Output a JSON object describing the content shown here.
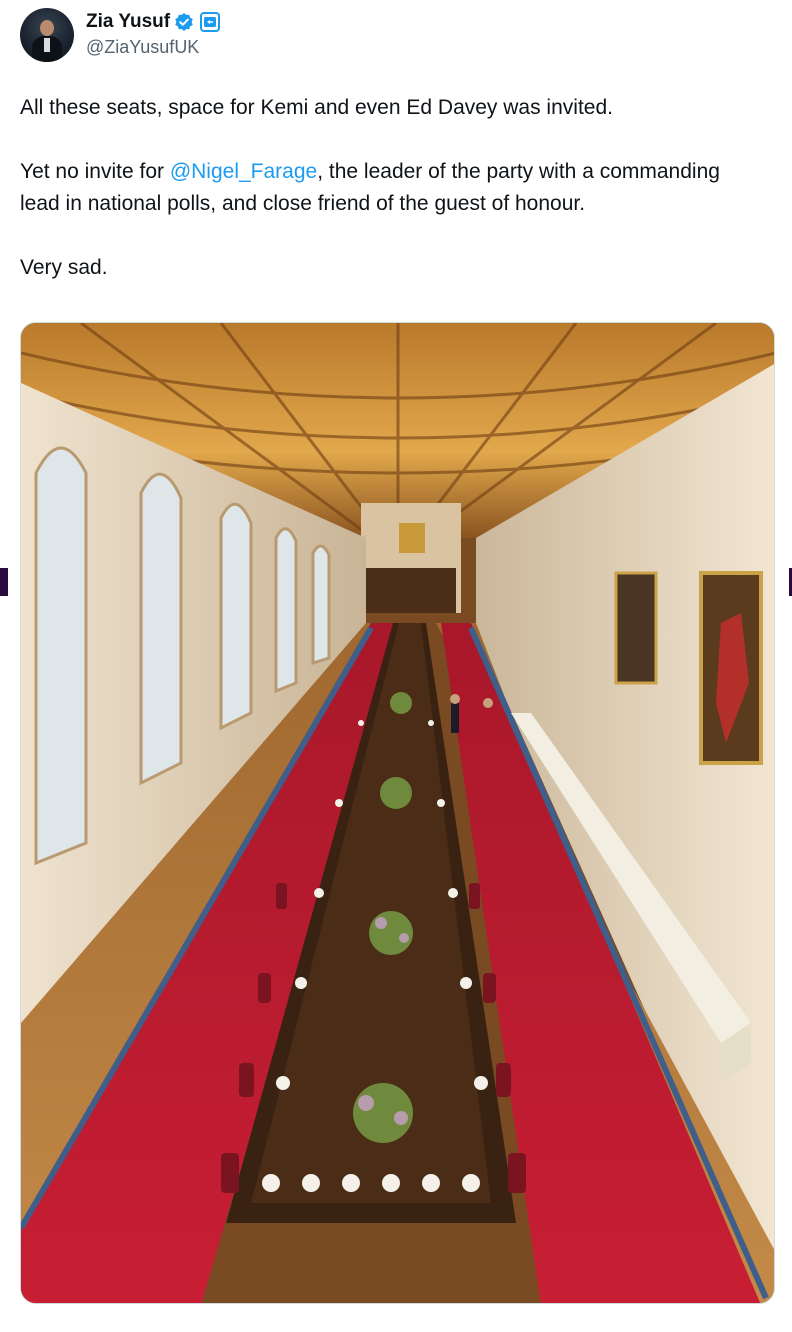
{
  "author": {
    "display_name": "Zia Yusuf",
    "handle": "@ZiaYusufUK",
    "verified": true,
    "avatar_icon": "profile-photo"
  },
  "tweet": {
    "line1": "All these seats, space for Kemi and even Ed Davey was invited.",
    "line2_prefix": "Yet no invite for ",
    "mention": "@Nigel_Farage",
    "line2_suffix": ", the leader of the party with a commanding lead in national polls, and close friend of the guest of honour.",
    "line3": "Very sad."
  },
  "media": {
    "type": "photo",
    "subject": "banquet hall with long dining table"
  },
  "colors": {
    "mention": "#1d9bf0",
    "verified": "#1d9bf0",
    "handle": "#536471",
    "text": "#0f1419"
  }
}
